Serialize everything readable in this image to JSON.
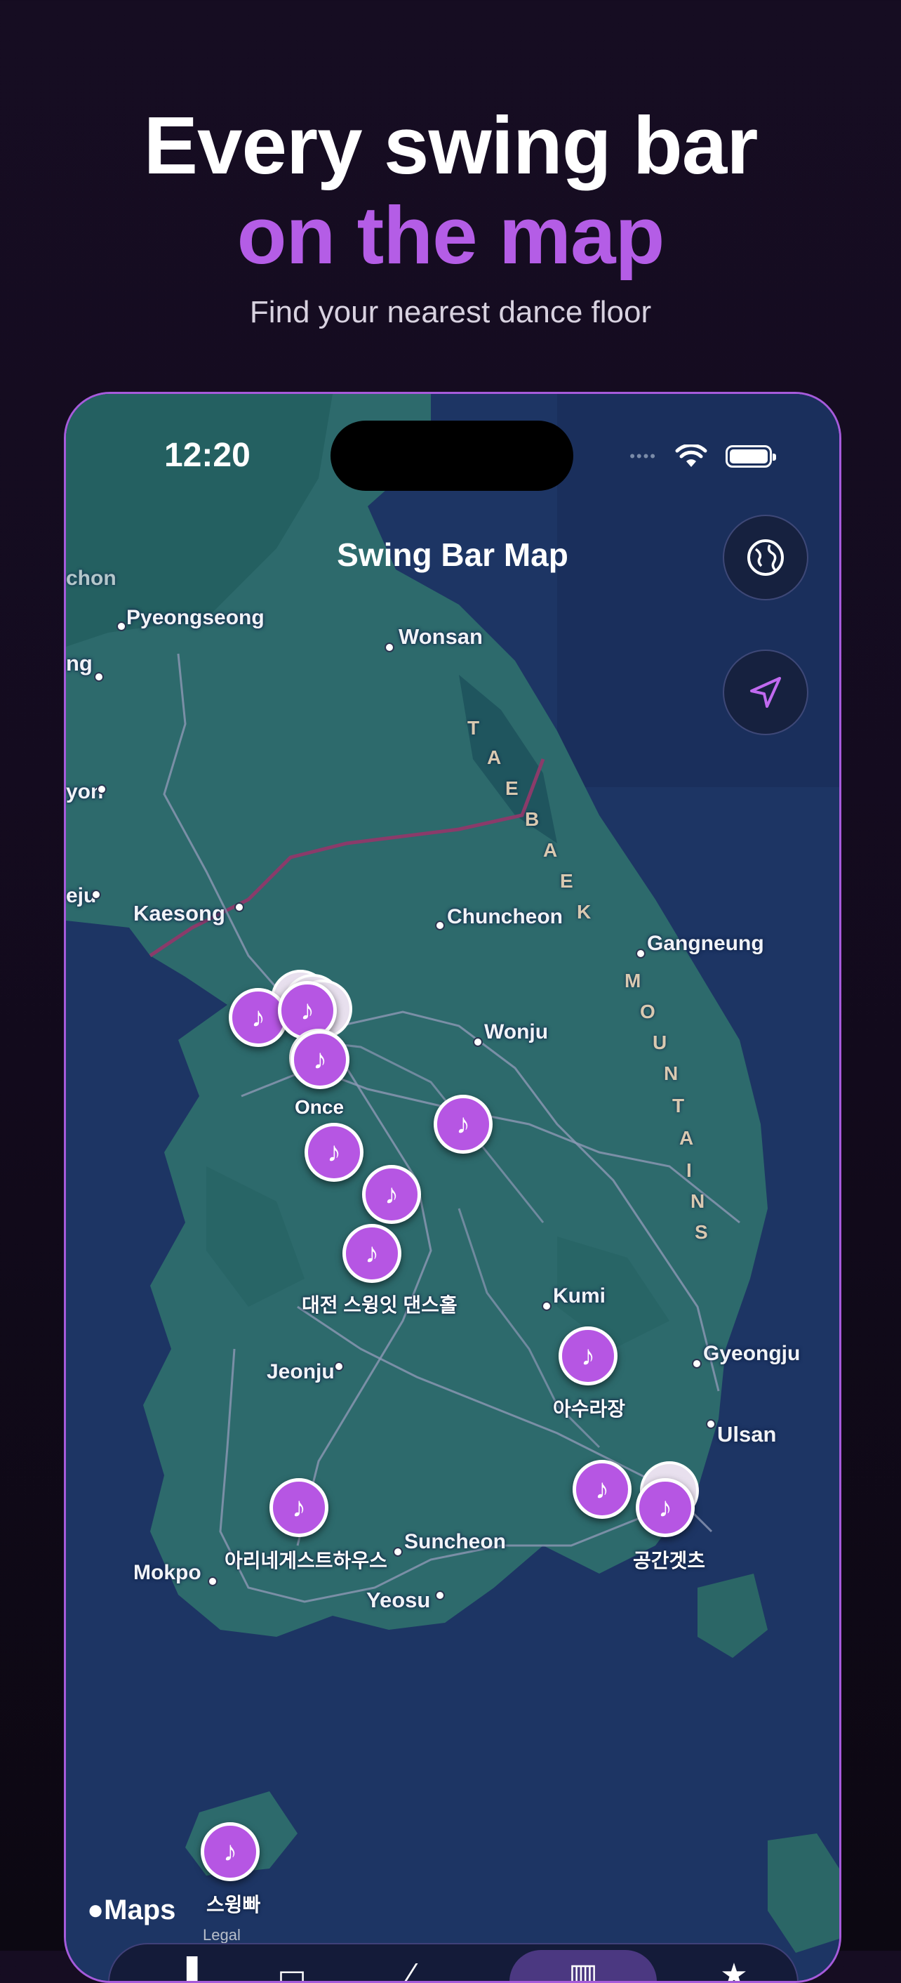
{
  "headline": {
    "line1": "Every swing bar",
    "line2": "on the map",
    "subtitle": "Find your nearest dance floor"
  },
  "colors": {
    "accent": "#b656e3",
    "frame": "#a65bdb",
    "land": "#2d6a6c",
    "sea": "#1d3564"
  },
  "status_bar": {
    "time": "12:20"
  },
  "screen": {
    "title": "Swing Bar Map"
  },
  "buttons": {
    "globe": "globe-icon",
    "location": "location-arrow-icon"
  },
  "cities": [
    {
      "name": "chon"
    },
    {
      "name": "Pyeongseong"
    },
    {
      "name": "Wonsan"
    },
    {
      "name": "ng"
    },
    {
      "name": "yon"
    },
    {
      "name": "eju"
    },
    {
      "name": "Kaesong"
    },
    {
      "name": "Chuncheon"
    },
    {
      "name": "Gangneung"
    },
    {
      "name": "Wonju"
    },
    {
      "name": "Kumi"
    },
    {
      "name": "Gyeongju"
    },
    {
      "name": "Ulsan"
    },
    {
      "name": "Jeonju"
    },
    {
      "name": "Suncheon"
    },
    {
      "name": "Mokpo"
    },
    {
      "name": "Yeosu"
    }
  ],
  "mountain_range": {
    "letters": [
      "T",
      "A",
      "E",
      "B",
      "A",
      "E",
      "K",
      "M",
      "O",
      "U",
      "N",
      "T",
      "A",
      "I",
      "N",
      "S"
    ]
  },
  "pins": {
    "icon": "♪",
    "labels": {
      "once": "Once",
      "daejeon": "대전 스윙잇 댄스홀",
      "asura": "아수라장",
      "arine": "아리네게스트하우스",
      "gonggan": "공간겟츠",
      "jeju": "스윙빠"
    }
  },
  "footer": {
    "maps_logo": "Maps",
    "legal": "Legal"
  }
}
